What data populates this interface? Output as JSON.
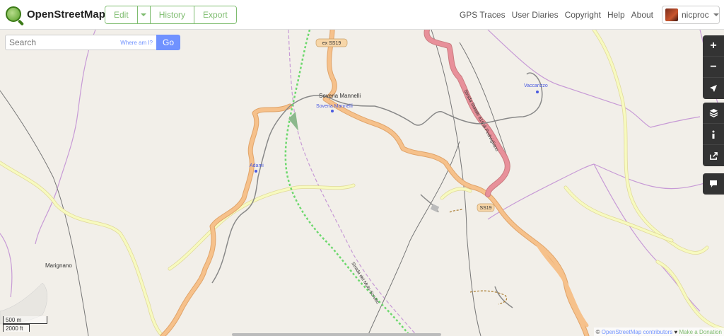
{
  "header": {
    "logo_text": "OpenStreetMap",
    "edit_label": "Edit",
    "history_label": "History",
    "export_label": "Export",
    "nav": [
      "GPS Traces",
      "User Diaries",
      "Copyright",
      "Help",
      "About"
    ],
    "user_name": "nicproc"
  },
  "search": {
    "placeholder": "Search",
    "where_am_i": "Where am I?",
    "go_label": "Go"
  },
  "map": {
    "labels": {
      "soveria_text": "Soveria Mannelli",
      "soveria_link": "Soveria Mannelli",
      "vaccarizzo": "Vaccarizzo",
      "adami": "Adami",
      "marignano": "Marignano",
      "road_ex_ss19": "ex SS19",
      "road_ss19": "SS19",
      "strada_616": "Strada Statale 616 di Pedivigliano",
      "strada_mulo": "Strada del Mulo-Scrutto"
    },
    "colors": {
      "background": "#f2efe9",
      "primary_road": "#f6c18b",
      "primary_casing": "#e0a46a",
      "trunk_road": "#e8909a",
      "secondary_road": "#f7fabf",
      "rail": "#777777",
      "admin_boundary": "#c79ad6",
      "path": "#6ed86e"
    }
  },
  "controls": {
    "zoom_in": "+",
    "zoom_out": "−"
  },
  "scale": {
    "metric": "500 m",
    "imperial": "2000 ft"
  },
  "attribution": {
    "copy": "©",
    "osm_link": "OpenStreetMap contributors",
    "heart": "♥",
    "donate": "Make a Donation"
  }
}
